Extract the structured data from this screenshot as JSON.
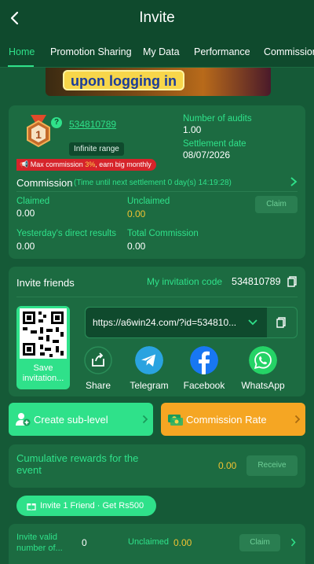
{
  "header": {
    "title": "Invite"
  },
  "tabs": [
    {
      "label": "Home"
    },
    {
      "label": "Promotion Sharing"
    },
    {
      "label": "My Data"
    },
    {
      "label": "Performance"
    },
    {
      "label": "Commission"
    }
  ],
  "banner": {
    "text": "upon logging in"
  },
  "level": {
    "number": "1",
    "help": "?",
    "user_id": "534810789",
    "range_badge": "Infinite range",
    "audits_label": "Number of audits",
    "audits_value": "1.00",
    "settlement_label": "Settlement date",
    "settlement_value": "08/07/2026",
    "max_commission_prefix": "Max commission ",
    "max_commission_pct": "3%",
    "max_commission_suffix": ", earn big monthly"
  },
  "commission": {
    "title": "Commission",
    "note": "(Time until next settlement  0 day(s) 14:19:28)",
    "claimed_label": "Claimed",
    "claimed_value": "0.00",
    "unclaimed_label": "Unclaimed",
    "unclaimed_value": "0.00",
    "claim_button": "Claim",
    "yesterday_label": "Yesterday's direct results",
    "yesterday_value": "0.00",
    "total_label": "Total Commission",
    "total_value": "0.00"
  },
  "invite": {
    "title": "Invite friends",
    "code_label": "My invitation code",
    "code_value": "534810789",
    "save_label": "Save invitation...",
    "link": "https://a6win24.com/?id=534810...",
    "share_items": [
      {
        "label": "Share",
        "icon": "share-icon",
        "color": "#1c6b41"
      },
      {
        "label": "Telegram",
        "icon": "telegram-icon",
        "color": "#2aa3e0"
      },
      {
        "label": "Facebook",
        "icon": "facebook-icon",
        "color": "#1877f2"
      },
      {
        "label": "WhatsApp",
        "icon": "whatsapp-icon",
        "color": "#25d366"
      }
    ]
  },
  "actions": {
    "create_sublevel": "Create sub-level",
    "commission_rate": "Commission Rate"
  },
  "rewards": {
    "label": "Cumulative rewards for the event",
    "value": "0.00",
    "receive_button": "Receive"
  },
  "promo": {
    "pill": "Invite 1 Friend · Get Rs500"
  },
  "valid": {
    "label": "Invite valid number of...",
    "value": "0",
    "unclaimed_label": "Unclaimed",
    "unclaimed_value": "0.00",
    "claim_button": "Claim"
  },
  "colors": {
    "background": "#155a37",
    "card": "#1c6b41",
    "accent": "#2fe18a",
    "gold": "#f1c232",
    "orange": "#f5a623",
    "danger": "#d6242a"
  }
}
